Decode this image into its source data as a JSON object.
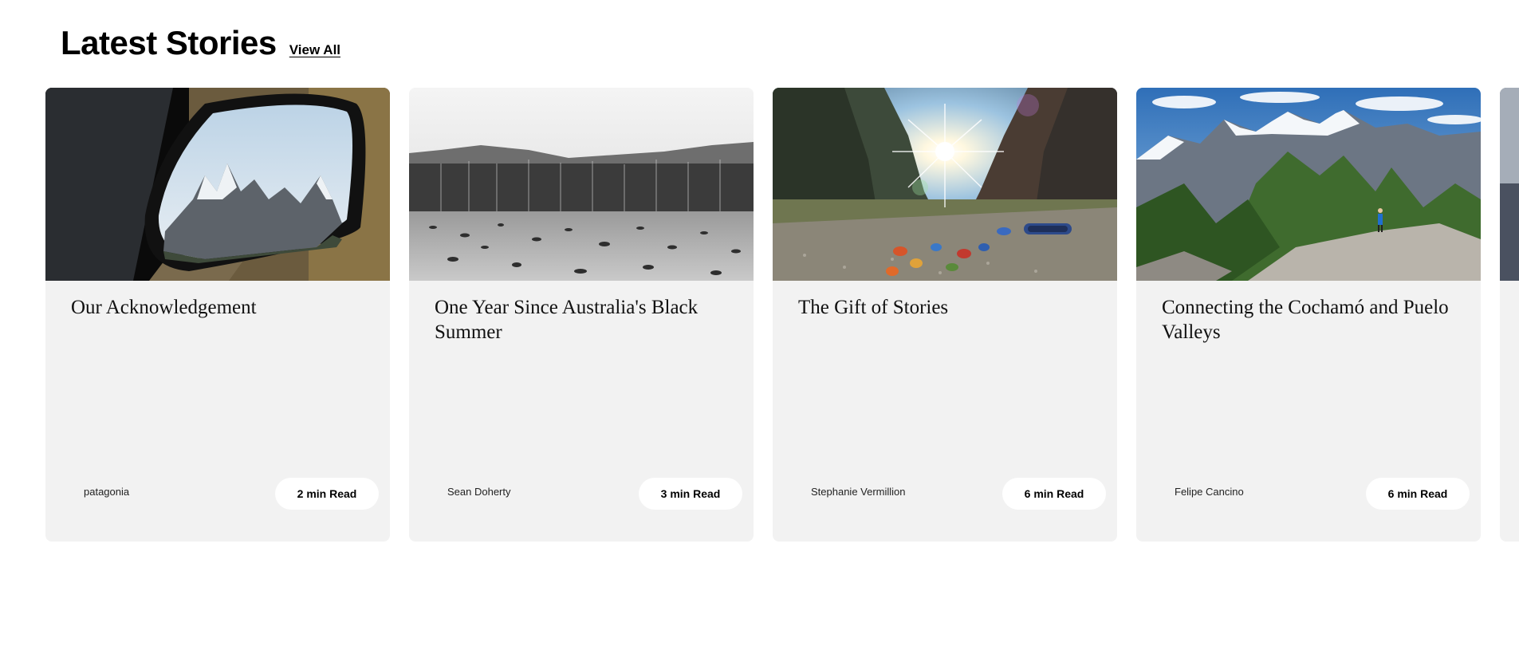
{
  "header": {
    "title": "Latest Stories",
    "view_all_label": "View All"
  },
  "stories": [
    {
      "title": "Our Acknowledgement",
      "author": "patagonia",
      "read_time": "2 min Read",
      "image": "mirror-mountains-photo"
    },
    {
      "title": "One Year Since Australia's Black Summer",
      "author": "Sean Doherty",
      "read_time": "3 min Read",
      "image": "burnt-forest-photo"
    },
    {
      "title": "The Gift of Stories",
      "author": "Stephanie Vermillion",
      "read_time": "6 min Read",
      "image": "river-canyon-sunburst-photo"
    },
    {
      "title": "Connecting the Cochamó and Puelo Valleys",
      "author": "Felipe Cancino",
      "read_time": "6 min Read",
      "image": "granite-valley-hiker-photo"
    }
  ],
  "colors": {
    "card_background": "#f2f2f2",
    "pill_background": "#ffffff",
    "text": "#000000"
  }
}
